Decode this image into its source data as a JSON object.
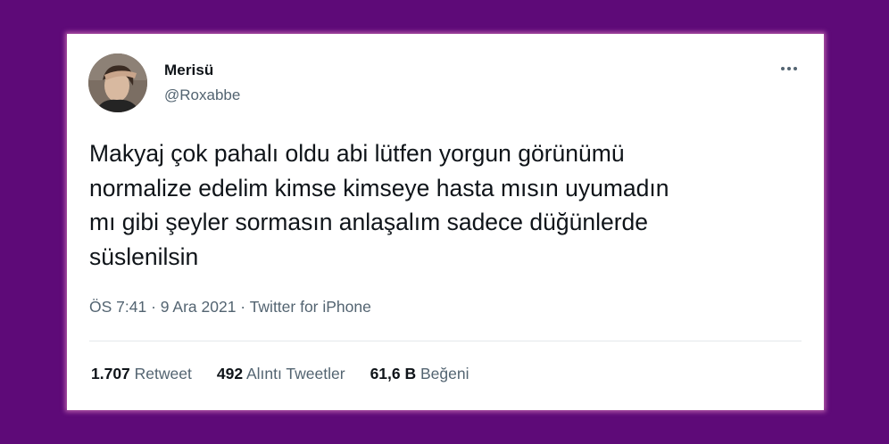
{
  "tweet": {
    "author": {
      "display_name": "Merisü",
      "handle": "@Roxabbe"
    },
    "more_icon": "more-horizontal-icon",
    "text": "Makyaj çok pahalı oldu abi lütfen yorgun görünümü\nnormalize edelim kimse kimseye hasta mısın uyumadın\nmı gibi şeyler sormasın anlaşalım sadece düğünlerde\nsüslenilsin",
    "meta": {
      "time": "ÖS 7:41",
      "separator": " · ",
      "date": "9 Ara 2021",
      "source": "Twitter for iPhone"
    },
    "stats": {
      "retweets": {
        "count": "1.707",
        "label": "Retweet"
      },
      "quotes": {
        "count": "492",
        "label": "Alıntı Tweetler"
      },
      "likes": {
        "count": "61,6 B",
        "label": "Beğeni"
      }
    }
  },
  "colors": {
    "background": "#5e0a78",
    "card": "#ffffff",
    "text_primary": "#0f1419",
    "text_secondary": "#536471"
  }
}
